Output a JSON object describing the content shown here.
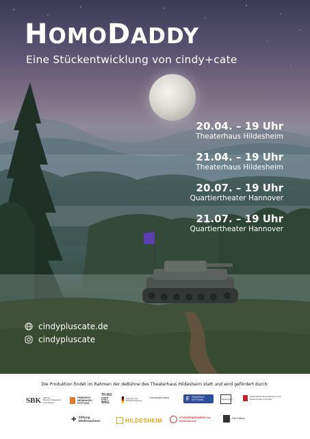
{
  "title_part1": "HOMO",
  "title_part2": "DADDY",
  "subtitle": "Eine Stückentwicklung von cindy+cate",
  "performances": [
    {
      "date": "20.04. – 19 Uhr",
      "venue": "Theaterhaus Hildesheim"
    },
    {
      "date": "21.04. – 19 Uhr",
      "venue": "Theaterhaus Hildesheim"
    },
    {
      "date": "20.07. – 19 Uhr",
      "venue": "Quartiertheater Hannover"
    },
    {
      "date": "21.07. – 19 Uhr",
      "venue": "Quartiertheater Hannover"
    }
  ],
  "contact": {
    "website": "cindypluscate.de",
    "instagram": "cindypluscate",
    "website_icon": "globe-icon",
    "instagram_icon": "instagram-icon"
  },
  "footer": {
    "funding_text": "Die Produktion findet im Rahmen der deBühne des Theaterhaus Hildesheim statt und wird gefördert durch:",
    "logos_row1": [
      {
        "mark": "SBK",
        "text": "Stiftung Braunschweigischer Kulturbesitz"
      },
      {
        "mark": "FR",
        "text": "FRIEDRICH WEINHAGEN STIFTUNG"
      },
      {
        "mark": "TH",
        "text": "TH RO OST WEG"
      },
      {
        "mark": "",
        "text": "Gefördert vom Bundesministerium"
      },
      {
        "mark": "",
        "text": "Demokratie leben!"
      },
      {
        "mark": "F",
        "text": "FRIEDRICH STIFTUNG"
      },
      {
        "mark": "",
        "text": "Theaterhaus"
      },
      {
        "mark": "",
        "text": "Niedersächsisches Ministerium für Wissenschaft und Kultur"
      }
    ],
    "logos_row2": [
      {
        "mark": "",
        "text": "Stiftung Niedersachsen"
      },
      {
        "mark": "",
        "text": "HILDESHEIM"
      },
      {
        "mark": "",
        "text": "STUDIERENDENWERK Ost-Niedersachsen"
      },
      {
        "mark": "",
        "text": "Die Falken"
      }
    ]
  },
  "colors": {
    "sky_top": "#3b3a55",
    "sky_mid": "#8f8a9b",
    "forest": "#2f3f33",
    "flag": "#5b3fb0",
    "text": "#ffffff"
  }
}
